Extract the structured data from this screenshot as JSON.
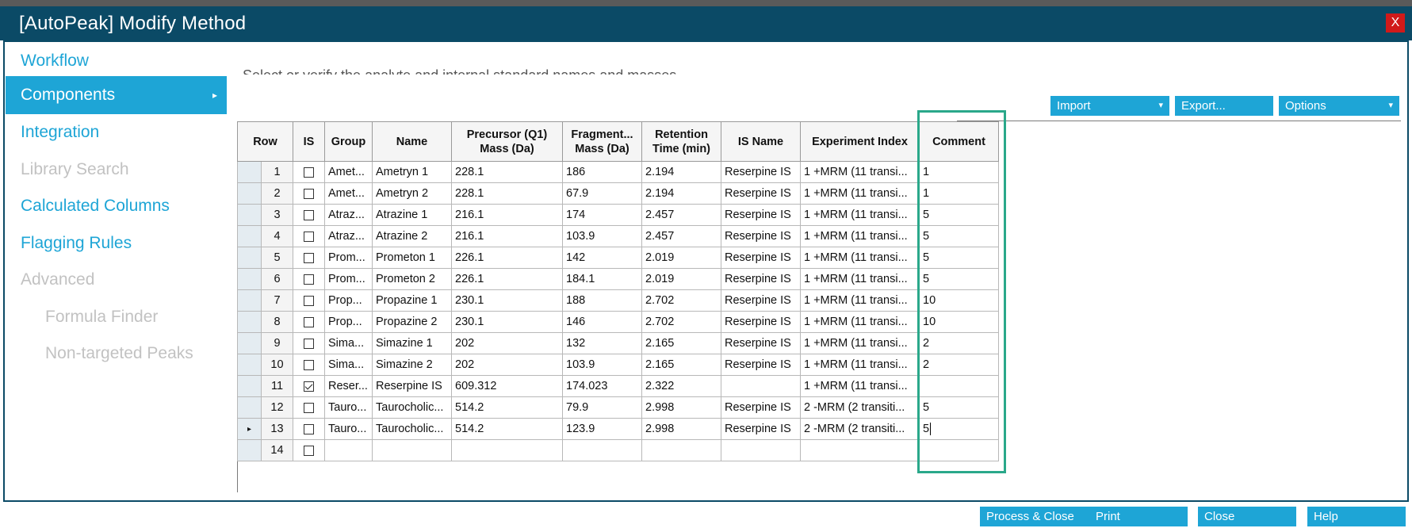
{
  "window": {
    "title": "[AutoPeak] Modify Method",
    "close_label": "X"
  },
  "nav": {
    "items": [
      {
        "label": "Workflow",
        "state": "enabled"
      },
      {
        "label": "Components",
        "state": "active"
      },
      {
        "label": "Integration",
        "state": "enabled"
      },
      {
        "label": "Library Search",
        "state": "disabled"
      },
      {
        "label": "Calculated Columns",
        "state": "enabled"
      },
      {
        "label": "Flagging Rules",
        "state": "enabled"
      },
      {
        "label": "Advanced",
        "state": "disabled"
      },
      {
        "label": "Formula Finder",
        "state": "disabled"
      },
      {
        "label": "Non-targeted Peaks",
        "state": "disabled"
      }
    ],
    "active_marker": "▸"
  },
  "instruction": "Select or verify the analyte and internal standard names and masses",
  "toolbar": {
    "import": "Import",
    "export": "Export...",
    "options": "Options",
    "dropdown_glyph": "▾"
  },
  "table": {
    "headers": [
      "Row",
      "IS",
      "Group",
      "Name",
      "Precursor (Q1) Mass (Da)",
      "Fragment... Mass (Da)",
      "Retention Time (min)",
      "IS Name",
      "Experiment Index",
      "Comment"
    ],
    "current_row_marker": "▸",
    "rows": [
      {
        "row": "1",
        "is": false,
        "group": "Amet...",
        "name": "Ametryn 1",
        "precursor": "228.1",
        "fragment": "186",
        "rt": "2.194",
        "is_name": "Reserpine IS",
        "exp": "1 +MRM (11 transi...",
        "comment": "1"
      },
      {
        "row": "2",
        "is": false,
        "group": "Amet...",
        "name": "Ametryn 2",
        "precursor": "228.1",
        "fragment": "67.9",
        "rt": "2.194",
        "is_name": "Reserpine IS",
        "exp": "1 +MRM (11 transi...",
        "comment": "1"
      },
      {
        "row": "3",
        "is": false,
        "group": "Atraz...",
        "name": "Atrazine 1",
        "precursor": "216.1",
        "fragment": "174",
        "rt": "2.457",
        "is_name": "Reserpine IS",
        "exp": "1 +MRM (11 transi...",
        "comment": "5"
      },
      {
        "row": "4",
        "is": false,
        "group": "Atraz...",
        "name": "Atrazine 2",
        "precursor": "216.1",
        "fragment": "103.9",
        "rt": "2.457",
        "is_name": "Reserpine IS",
        "exp": "1 +MRM (11 transi...",
        "comment": "5"
      },
      {
        "row": "5",
        "is": false,
        "group": "Prom...",
        "name": "Prometon 1",
        "precursor": "226.1",
        "fragment": "142",
        "rt": "2.019",
        "is_name": "Reserpine IS",
        "exp": "1 +MRM (11 transi...",
        "comment": "5"
      },
      {
        "row": "6",
        "is": false,
        "group": "Prom...",
        "name": "Prometon 2",
        "precursor": "226.1",
        "fragment": "184.1",
        "rt": "2.019",
        "is_name": "Reserpine IS",
        "exp": "1 +MRM (11 transi...",
        "comment": "5"
      },
      {
        "row": "7",
        "is": false,
        "group": "Prop...",
        "name": "Propazine 1",
        "precursor": "230.1",
        "fragment": "188",
        "rt": "2.702",
        "is_name": "Reserpine IS",
        "exp": "1 +MRM (11 transi...",
        "comment": "10"
      },
      {
        "row": "8",
        "is": false,
        "group": "Prop...",
        "name": "Propazine 2",
        "precursor": "230.1",
        "fragment": "146",
        "rt": "2.702",
        "is_name": "Reserpine IS",
        "exp": "1 +MRM (11 transi...",
        "comment": "10"
      },
      {
        "row": "9",
        "is": false,
        "group": "Sima...",
        "name": "Simazine 1",
        "precursor": "202",
        "fragment": "132",
        "rt": "2.165",
        "is_name": "Reserpine IS",
        "exp": "1 +MRM (11 transi...",
        "comment": "2"
      },
      {
        "row": "10",
        "is": false,
        "group": "Sima...",
        "name": "Simazine 2",
        "precursor": "202",
        "fragment": "103.9",
        "rt": "2.165",
        "is_name": "Reserpine IS",
        "exp": "1 +MRM (11 transi...",
        "comment": "2"
      },
      {
        "row": "11",
        "is": true,
        "group": "Reser...",
        "name": "Reserpine IS",
        "precursor": "609.312",
        "fragment": "174.023",
        "rt": "2.322",
        "is_name": "",
        "exp": "1 +MRM (11 transi...",
        "comment": ""
      },
      {
        "row": "12",
        "is": false,
        "group": "Tauro...",
        "name": "Taurocholic...",
        "precursor": "514.2",
        "fragment": "79.9",
        "rt": "2.998",
        "is_name": "Reserpine IS",
        "exp": "2 -MRM (2 transiti...",
        "comment": "5"
      },
      {
        "row": "13",
        "is": false,
        "group": "Tauro...",
        "name": "Taurocholic...",
        "precursor": "514.2",
        "fragment": "123.9",
        "rt": "2.998",
        "is_name": "Reserpine IS",
        "exp": "2 -MRM (2 transiti...",
        "comment": "5",
        "current": true,
        "editing": true
      },
      {
        "row": "14",
        "is": false,
        "group": "",
        "name": "",
        "precursor": "",
        "fragment": "",
        "rt": "",
        "is_name": "",
        "exp": "",
        "comment": ""
      }
    ]
  },
  "footer": {
    "process_close": "Process & Close",
    "print": "Print",
    "close": "Close",
    "help": "Help"
  },
  "colors": {
    "titlebar": "#0b4a66",
    "accent": "#1ea5d6",
    "close": "#d11a1a",
    "highlight": "#2aa88a",
    "disabled": "#c2c2c2"
  }
}
